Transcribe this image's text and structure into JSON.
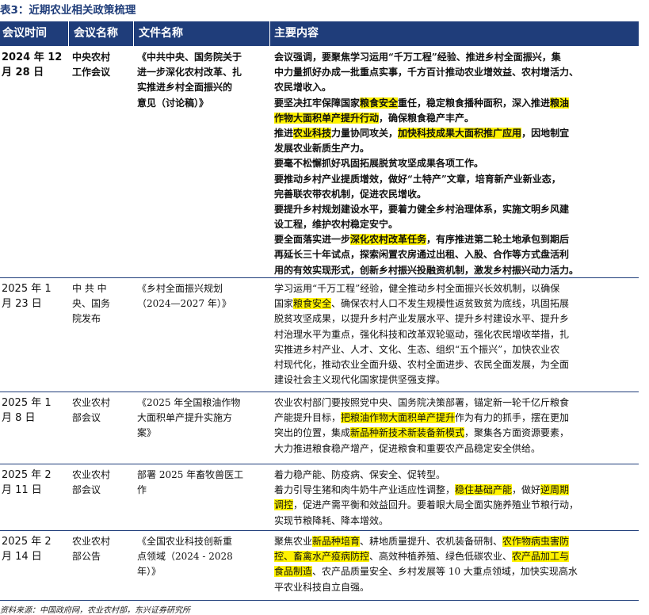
{
  "title": "表3：近期农业相关政策梳理",
  "headers": [
    "会议时间",
    "会议名称",
    "文件名称",
    "主要内容"
  ],
  "rows": [
    {
      "bold": true,
      "date": [
        "2024 年 12",
        "月 28 日"
      ],
      "meeting": [
        "中央农村",
        "工作会议"
      ],
      "document": [
        "《中共中央、国务院关于",
        "进一步深化农村改革、扎",
        "实推进乡村全面振兴的",
        "意见（讨论稿）》"
      ],
      "content": [
        [
          {
            "t": "会议强调，要聚焦学习运用“千万工程”经验、推进乡村全面振兴，集"
          }
        ],
        [
          {
            "t": "中力量抓好办成一批重点实事，千方百计推动农业增效益、农村增活力、"
          }
        ],
        [
          {
            "t": "农民增收入。"
          }
        ],
        [
          {
            "t": "要坚决扛牢保障国家"
          },
          {
            "t": "粮食安全",
            "h": true
          },
          {
            "t": "重任，稳定粮食播种面积，深入推进"
          },
          {
            "t": "粮油",
            "h": true
          }
        ],
        [
          {
            "t": "作物大面积单产提升行动",
            "h": true
          },
          {
            "t": "，确保粮食稳产丰产。"
          }
        ],
        [
          {
            "t": "推进"
          },
          {
            "t": "农业科技",
            "h": true
          },
          {
            "t": "力量协同攻关，"
          },
          {
            "t": "加快科技成果大面积推广应用",
            "h": true
          },
          {
            "t": "，因地制宜"
          }
        ],
        [
          {
            "t": "发展农业新质生产力。"
          }
        ],
        [
          {
            "t": "要毫不松懈抓好巩固拓展脱贫攻坚成果各项工作。"
          }
        ],
        [
          {
            "t": "要推动乡村产业提质增效，做好“土特产”文章，培育新产业新业态，"
          }
        ],
        [
          {
            "t": "完善联农带农机制，促进农民增收。"
          }
        ],
        [
          {
            "t": "要提升乡村规划建设水平，要着力健全乡村治理体系，实施文明乡风建"
          }
        ],
        [
          {
            "t": "设工程，维护农村稳定安宁。"
          }
        ],
        [
          {
            "t": "要全面落实进一步"
          },
          {
            "t": "深化农村改革任务",
            "h": true
          },
          {
            "t": "，有序推进第二轮土地承包到期后"
          }
        ],
        [
          {
            "t": "再延长三十年试点，探索闲置农房通过出租、入股、合作等方式盘活利"
          }
        ],
        [
          {
            "t": "用的有效实现形式，创新乡村振兴投融资机制，激发乡村振兴动力活力。"
          }
        ]
      ]
    },
    {
      "bold": false,
      "date": [
        "2025 年 1",
        "月 23 日"
      ],
      "meeting": [
        "中 共 中",
        "央、国务",
        "院发布"
      ],
      "document": [
        "《乡村全面振兴规划",
        "（2024—2027 年）》"
      ],
      "content": [
        [
          {
            "t": "学习运用“千万工程”经验，健全推动乡村全面振兴长效机制，以确保"
          }
        ],
        [
          {
            "t": "国家"
          },
          {
            "t": "粮食安全",
            "h": true
          },
          {
            "t": "、确保农村人口不发生规模性返贫致贫为底线，巩固拓展"
          }
        ],
        [
          {
            "t": "脱贫攻坚成果，以提升乡村产业发展水平、提升乡村建设水平、提升乡"
          }
        ],
        [
          {
            "t": "村治理水平为重点，强化科技和改革双轮驱动，强化农民增收举措，扎"
          }
        ],
        [
          {
            "t": "实推进乡村产业、人才、文化、生态、组织“五个振兴”，加快农业农"
          }
        ],
        [
          {
            "t": "村现代化，推动农业全面升级、农村全面进步、农民全面发展，为全面"
          }
        ],
        [
          {
            "t": "建设社会主义现代化国家提供坚强支撑。"
          }
        ]
      ]
    },
    {
      "bold": false,
      "date": [
        "2025 年 1",
        "月 8 日"
      ],
      "meeting": [
        "农业农村",
        "部会议"
      ],
      "document": [
        "《2025 年全国粮油作物",
        "大面积单产提升实施方",
        "案》"
      ],
      "content": [
        [
          {
            "t": "农业农村部门要按照党中央、国务院决策部署，锚定新一轮千亿斤粮食"
          }
        ],
        [
          {
            "t": "产能提升目标，"
          },
          {
            "t": "把粮油作物大面积单产提升",
            "h": true
          },
          {
            "t": "作为有力的抓手，摆在更加"
          }
        ],
        [
          {
            "t": "突出的位置，集成"
          },
          {
            "t": "新品种新技术新装备新模式",
            "h": true
          },
          {
            "t": "，聚集各方面资源要素，"
          }
        ],
        [
          {
            "t": "大力推进粮食稳产增产，促进粮食和重要农产品稳定安全供给。"
          }
        ]
      ]
    },
    {
      "bold": false,
      "date": [
        "2025 年 2",
        "月 11 日"
      ],
      "meeting": [
        "农业农村",
        "部会议"
      ],
      "document": [
        "部署 2025 年畜牧兽医工",
        "作"
      ],
      "content": [
        [
          {
            "t": "着力稳产能、防疫病、保安全、促转型。"
          }
        ],
        [
          {
            "t": "着力引导生猪和肉牛奶牛产业适应性调整，"
          },
          {
            "t": "稳住基础产能",
            "h": true
          },
          {
            "t": "，做好"
          },
          {
            "t": "逆周期",
            "h": true
          }
        ],
        [
          {
            "t": "调控",
            "h": true
          },
          {
            "t": "，促进产需平衡和效益回升。要着眼大局全面实施养殖业节粮行动，"
          }
        ],
        [
          {
            "t": "实现节粮降耗、降本增效。"
          }
        ]
      ]
    },
    {
      "bold": false,
      "date": [
        "2025 年 2",
        "月 14 日"
      ],
      "meeting": [
        "农业农村",
        "部公告"
      ],
      "document": [
        "《全国农业科技创新重",
        "点领域（2024 - 2028",
        "年）》"
      ],
      "content": [
        [
          {
            "t": "聚焦农业"
          },
          {
            "t": "新品种培育",
            "h": true
          },
          {
            "t": "、耕地质量提升、农机装备研制、"
          },
          {
            "t": "农作物病虫害防",
            "h": true
          }
        ],
        [
          {
            "t": "控、畜禽水产疫病防控",
            "h": true
          },
          {
            "t": "、高效种植养殖、绿色低碳农业、"
          },
          {
            "t": "农产品加工与",
            "h": true
          }
        ],
        [
          {
            "t": "食品制造",
            "h": true
          },
          {
            "t": "、农产品质量安全、乡村发展等 10 大重点领域，加快实现高水"
          }
        ],
        [
          {
            "t": "平农业科技自立自强。"
          }
        ]
      ]
    }
  ],
  "source": "资料来源：中国政府网，农业农村部，东兴证券研究所"
}
